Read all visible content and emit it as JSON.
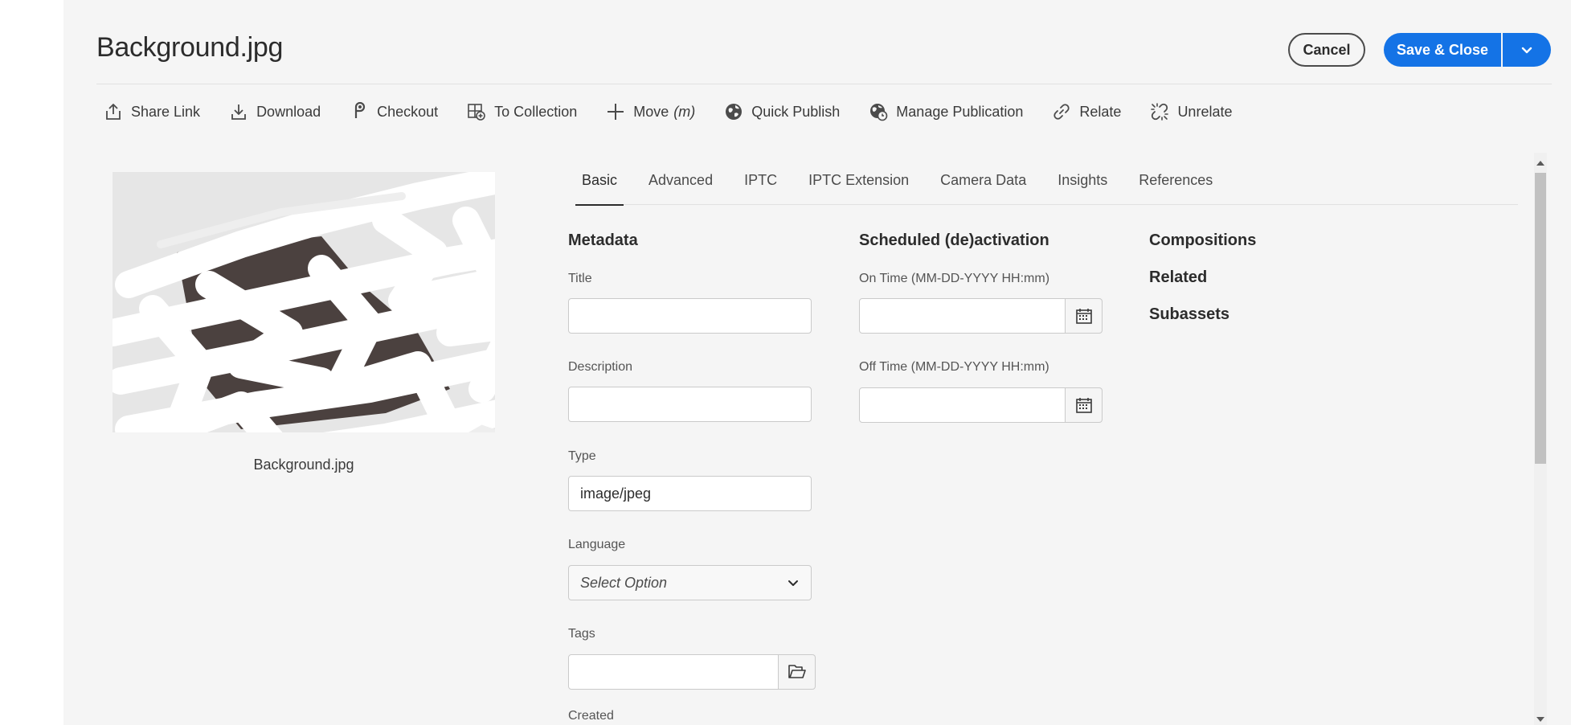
{
  "page": {
    "title": "Background.jpg"
  },
  "header": {
    "cancel_label": "Cancel",
    "save_label": "Save & Close",
    "save_menu_icon": "chevron-down-icon"
  },
  "toolbar": {
    "items": [
      {
        "label": "Share Link",
        "icon": "share-icon"
      },
      {
        "label": "Download",
        "icon": "download-icon"
      },
      {
        "label": "Checkout",
        "icon": "checkout-icon"
      },
      {
        "label": "To Collection",
        "icon": "collection-add-icon"
      },
      {
        "label": "Move",
        "hint": "(m)",
        "icon": "move-icon"
      },
      {
        "label": "Quick Publish",
        "icon": "globe-icon"
      },
      {
        "label": "Manage Publication",
        "icon": "globe-clock-icon"
      },
      {
        "label": "Relate",
        "icon": "link-icon"
      },
      {
        "label": "Unrelate",
        "icon": "unlink-icon"
      }
    ]
  },
  "preview": {
    "filename": "Background.jpg"
  },
  "tabs": [
    {
      "label": "Basic",
      "active": true
    },
    {
      "label": "Advanced",
      "active": false
    },
    {
      "label": "IPTC",
      "active": false
    },
    {
      "label": "IPTC Extension",
      "active": false
    },
    {
      "label": "Camera Data",
      "active": false
    },
    {
      "label": "Insights",
      "active": false
    },
    {
      "label": "References",
      "active": false
    }
  ],
  "metadata": {
    "heading": "Metadata",
    "title_label": "Title",
    "title_value": "",
    "description_label": "Description",
    "description_value": "",
    "type_label": "Type",
    "type_value": "image/jpeg",
    "language_label": "Language",
    "language_placeholder": "Select Option",
    "tags_label": "Tags",
    "tags_value": "",
    "created_label": "Created"
  },
  "schedule": {
    "heading": "Scheduled (de)activation",
    "on_time_label": "On Time (MM-DD-YYYY HH:mm)",
    "on_time_value": "",
    "off_time_label": "Off Time (MM-DD-YYYY HH:mm)",
    "off_time_value": ""
  },
  "related_sections": {
    "compositions": "Compositions",
    "related": "Related",
    "subassets": "Subassets"
  },
  "colors": {
    "accent": "#1473e6",
    "background": "#f5f5f5",
    "text": "#2c2c2c"
  }
}
